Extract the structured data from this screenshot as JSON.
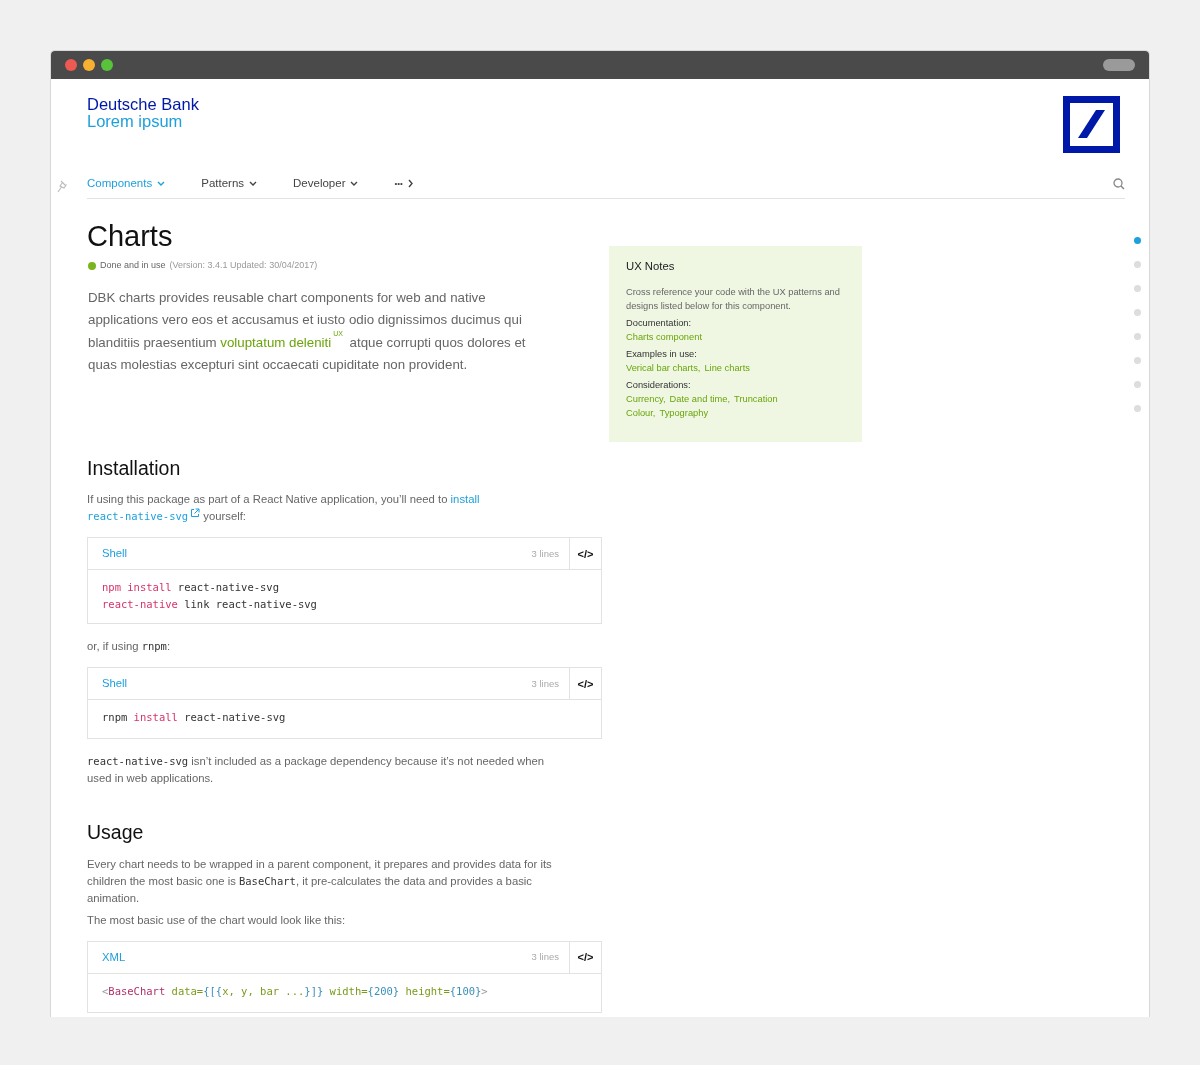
{
  "brand": {
    "name": "Deutsche Bank",
    "subtitle": "Lorem ipsum"
  },
  "nav": {
    "items": [
      {
        "label": "Components",
        "kind": "dropdown",
        "selected": true
      },
      {
        "label": "Patterns",
        "kind": "dropdown",
        "selected": false
      },
      {
        "label": "Developer",
        "kind": "dropdown",
        "selected": false
      },
      {
        "label": "•••",
        "kind": "more",
        "selected": false
      }
    ]
  },
  "page": {
    "title": "Charts",
    "status": {
      "label": "Done and in use",
      "color": "#7ab51d",
      "meta": "(Version: 3.4.1  Updated: 30/04/2017)"
    },
    "intro": [
      {
        "text": "DBK charts provides reusable chart components for web and native applications vero eos et accusamus et iusto odio dignissimos ducimus qui blanditiis praesentium ",
        "kind": "text"
      },
      {
        "text": "voluptatum deleniti",
        "kind": "link"
      },
      {
        "text": "UX",
        "kind": "badge"
      },
      {
        "text": " atque corrupti quos dolores et quas molestias excepturi sint occaecati cupiditate non provident.",
        "kind": "text"
      }
    ]
  },
  "sections": [
    {
      "heading": "Installation",
      "blocks": [
        {
          "kind": "paragraph",
          "segments": [
            {
              "text": "If using this package as part of a React Native application, you’ll need to ",
              "kind": "text"
            },
            {
              "text": "install",
              "kind": "link"
            },
            {
              "text": "react-native-svg",
              "kind": "linkcode"
            },
            {
              "text": " yourself:",
              "kind": "text"
            }
          ]
        },
        {
          "kind": "code",
          "language": "Shell",
          "line_count": "3 lines",
          "toggle": "</>",
          "lines": [
            [
              {
                "text": "npm install",
                "kind": "keyword"
              },
              {
                "text": " react-native-svg",
                "kind": "plain"
              }
            ],
            [
              {
                "text": "react-native",
                "kind": "keyword"
              },
              {
                "text": " link react-native-svg",
                "kind": "plain"
              }
            ]
          ]
        },
        {
          "kind": "paragraph",
          "segments": [
            {
              "text": "or, if using ",
              "kind": "text"
            },
            {
              "text": "rnpm",
              "kind": "code"
            },
            {
              "text": ":",
              "kind": "text"
            }
          ]
        },
        {
          "kind": "code",
          "language": "Shell",
          "line_count": "3 lines",
          "toggle": "</>",
          "lines": [
            [
              {
                "text": "rnpm ",
                "kind": "plain"
              },
              {
                "text": "install",
                "kind": "keyword"
              },
              {
                "text": " react-native-svg",
                "kind": "plain"
              }
            ]
          ]
        },
        {
          "kind": "paragraph",
          "segments": [
            {
              "text": "react-native-svg",
              "kind": "code"
            },
            {
              "text": " isn’t included as a package dependency because it’s not needed when used in web applications.",
              "kind": "text"
            }
          ]
        }
      ]
    },
    {
      "heading": "Usage",
      "blocks": [
        {
          "kind": "paragraph",
          "segments": [
            {
              "text": "Every chart needs to be wrapped in a parent component, it prepares and provides data for its children the most basic one is ",
              "kind": "text"
            },
            {
              "text": "BaseChart",
              "kind": "code"
            },
            {
              "text": ", it pre-calculates the data and provides a basic animation.",
              "kind": "text"
            }
          ]
        },
        {
          "kind": "paragraph",
          "segments": [
            {
              "text": "The most basic use of the chart would look like this:",
              "kind": "text"
            }
          ]
        },
        {
          "kind": "code",
          "language": "XML",
          "line_count": "3 lines",
          "toggle": "</>",
          "lines": [
            [
              {
                "text": "<",
                "kind": "punct"
              },
              {
                "text": "BaseChart",
                "kind": "tag"
              },
              {
                "text": " data=",
                "kind": "attr"
              },
              {
                "text": "{[{",
                "kind": "value"
              },
              {
                "text": "x, y, bar ...",
                "kind": "attr"
              },
              {
                "text": "}]}",
                "kind": "value"
              },
              {
                "text": " width=",
                "kind": "attr"
              },
              {
                "text": "{200}",
                "kind": "value"
              },
              {
                "text": " height=",
                "kind": "attr"
              },
              {
                "text": "{100}",
                "kind": "value"
              },
              {
                "text": ">",
                "kind": "punct"
              }
            ]
          ]
        }
      ]
    }
  ],
  "notes": {
    "title": "UX Notes",
    "description": "Cross reference your code with the UX patterns and designs listed below for this component.",
    "groups": [
      {
        "label": "Documentation:",
        "lines": [
          [
            "Charts component"
          ]
        ]
      },
      {
        "label": "Examples in use:",
        "lines": [
          [
            "Verical bar charts,",
            "Line charts"
          ]
        ]
      },
      {
        "label": "Considerations:",
        "lines": [
          [
            "Currency,",
            "Date and time,",
            "Truncation"
          ],
          [
            "Colour,",
            "Typography"
          ]
        ]
      }
    ]
  },
  "section_nav": {
    "dots": [
      {
        "selected": true
      },
      {
        "selected": false
      },
      {
        "selected": false
      },
      {
        "selected": false
      },
      {
        "selected": false
      },
      {
        "selected": false
      },
      {
        "selected": false
      },
      {
        "selected": false
      }
    ]
  }
}
